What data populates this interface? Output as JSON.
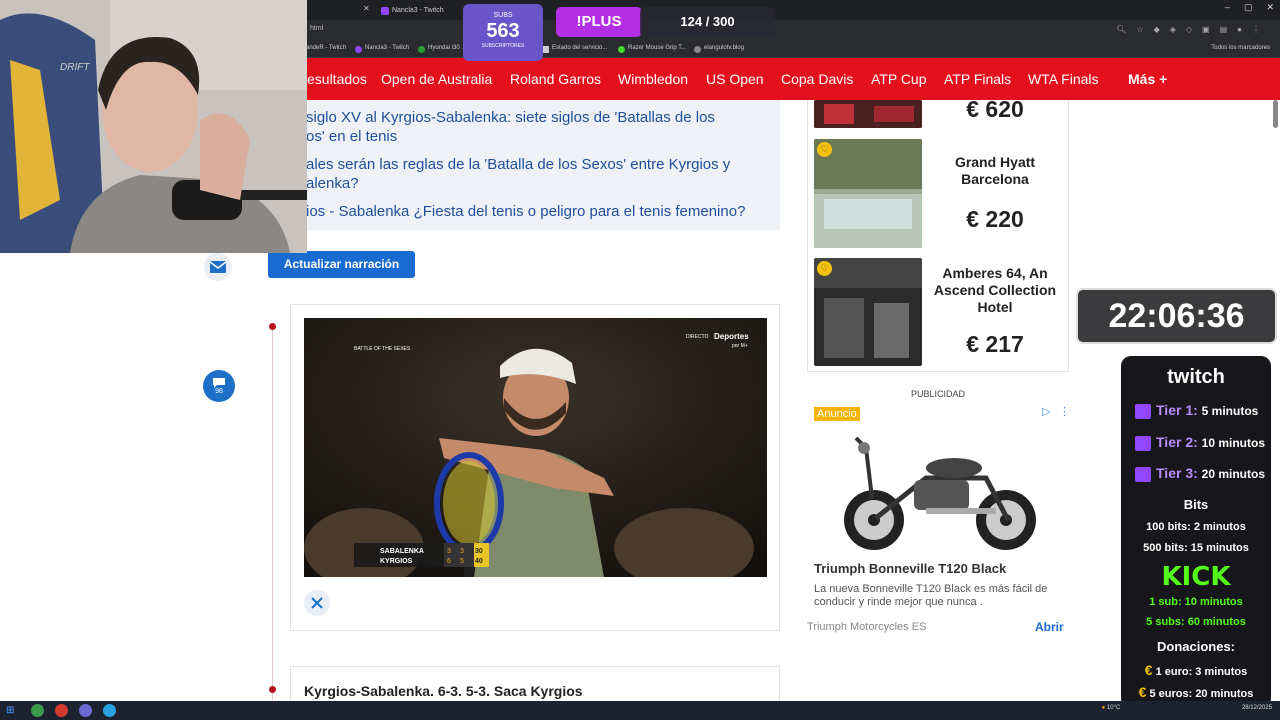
{
  "browser": {
    "tabs": [
      "Nancla3 - Twitch"
    ],
    "url": "html",
    "bookmarks": [
      "andeR - Twitch",
      "Nancla3 - Twitch",
      "Hyundai i30 ...",
      "Estado del servicio...",
      "Razer Mouse Grip T...",
      "elangulotv.blog"
    ],
    "bookmarks_right": "Todos los marcadores"
  },
  "site_nav": {
    "items": [
      "esultados",
      "Open de Australia",
      "Roland Garros",
      "Wimbledon",
      "US Open",
      "Copa Davis",
      "ATP Cup",
      "ATP Finals",
      "WTA Finals"
    ],
    "more": "Más +"
  },
  "related": {
    "links": [
      "siglo XV al Kyrgios-Sabalenka: siete siglos de 'Batallas de los",
      "os' en el tenis",
      "ales serán las reglas de la 'Batalla de los Sexos' entre Kyrgios y",
      "alenka?",
      "ios - Sabalenka ¿Fiesta del tenis o peligro para el tenis femenino?"
    ]
  },
  "live": {
    "update_button": "Actualizar narración",
    "comment_count": "98",
    "next_post_title": "Kyrgios-Sabalenka. 6-3. 5-3. Saca Kyrgios"
  },
  "video": {
    "broadcaster": "Deportes",
    "broadcaster_sub": "por M+",
    "live_label": "DIRECTO",
    "event_logo": "BATTLE OF THE SEXES",
    "score": {
      "players": [
        "SABALENKA",
        "KYRGIOS"
      ],
      "sets": [
        [
          "3",
          "3"
        ],
        [
          "6",
          "5"
        ]
      ],
      "points": [
        "30",
        "40"
      ]
    }
  },
  "hotels": [
    {
      "name": "",
      "price": "€ 620"
    },
    {
      "name": "Grand Hyatt Barcelona",
      "price": "€ 220"
    },
    {
      "name": "Amberes 64, An Ascend Collection Hotel",
      "price": "€ 217"
    }
  ],
  "ad": {
    "label": "PUBLICIDAD",
    "badge": "Anuncio",
    "title": "Triumph Bonneville T120 Black",
    "description": "La nueva Bonneville T120 Black es más fácil de conducir y rinde mejor que nunca .",
    "brand": "Triumph Motorcycles ES",
    "cta": "Abrir"
  },
  "stream": {
    "subs_label": "SUBS",
    "subs_count": "563",
    "subs_sub": "SUBSCRIPTORES",
    "plus": "!PLUS",
    "progress": "124 / 300",
    "clock": "22:06:36",
    "panel": {
      "twitch": "twitch",
      "tiers": [
        {
          "label": "Tier 1:",
          "value": "5 minutos"
        },
        {
          "label": "Tier 2:",
          "value": "10 minutos"
        },
        {
          "label": "Tier 3:",
          "value": "20 minutos"
        }
      ],
      "bits_title": "Bits",
      "bits": [
        "100 bits: 2 minutos",
        "500 bits: 15 minutos"
      ],
      "kick": "KICK",
      "kick_rules": [
        "1 sub: 10 minutos",
        "5 subs: 60 minutos"
      ],
      "donations_title": "Donaciones:",
      "donations": [
        "1 euro: 3 minutos",
        "5 euros: 20 minutos"
      ]
    }
  },
  "taskbar": {
    "weather": "10°C",
    "date": "28/12/2025"
  },
  "colors": {
    "site_red": "#e5101d",
    "link_blue": "#1f4f9a",
    "button_blue": "#1a6bd1",
    "twitch_purple": "#9146ff",
    "kick_green": "#53fc18"
  }
}
